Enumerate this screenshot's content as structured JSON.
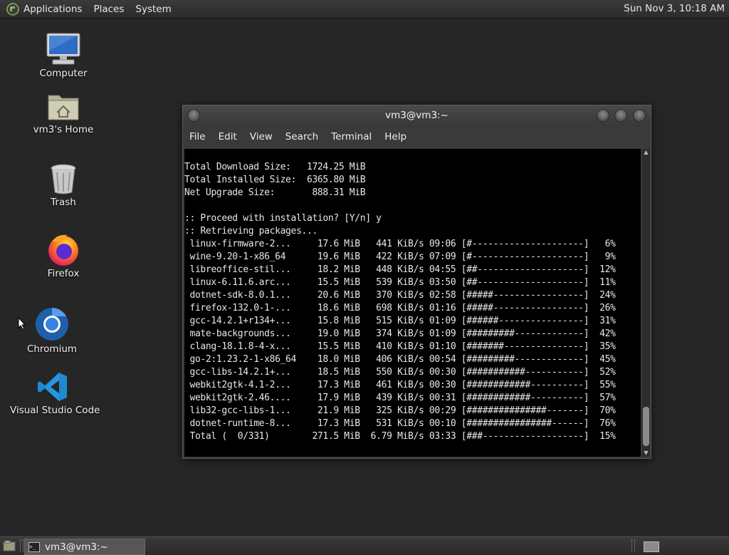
{
  "top_panel": {
    "menus": [
      "Applications",
      "Places",
      "System"
    ],
    "clock": "Sun Nov  3, 10:18 AM"
  },
  "desktop": {
    "icons": [
      {
        "label": "Computer",
        "icon": "computer-icon"
      },
      {
        "label": "vm3's Home",
        "icon": "home-folder-icon"
      },
      {
        "label": "Trash",
        "icon": "trash-icon"
      },
      {
        "label": "Firefox",
        "icon": "firefox-icon"
      },
      {
        "label": "Chromium",
        "icon": "chromium-icon"
      },
      {
        "label": "Visual Studio Code",
        "icon": "vscode-icon"
      }
    ]
  },
  "terminal": {
    "title": "vm3@vm3:~",
    "menu": [
      "File",
      "Edit",
      "View",
      "Search",
      "Terminal",
      "Help"
    ],
    "lines": [
      "Total Download Size:   1724.25 MiB",
      "Total Installed Size:  6365.80 MiB",
      "Net Upgrade Size:       888.31 MiB",
      "",
      ":: Proceed with installation? [Y/n] y",
      ":: Retrieving packages...",
      " linux-firmware-2...     17.6 MiB   441 KiB/s 09:06 [#---------------------]   6%",
      " wine-9.20-1-x86_64      19.6 MiB   422 KiB/s 07:09 [#---------------------]   9%",
      " libreoffice-stil...     18.2 MiB   448 KiB/s 04:55 [##--------------------]  12%",
      " linux-6.11.6.arc...     15.5 MiB   539 KiB/s 03:50 [##--------------------]  11%",
      " dotnet-sdk-8.0.1...     20.6 MiB   370 KiB/s 02:58 [#####-----------------]  24%",
      " firefox-132.0-1-...     18.6 MiB   698 KiB/s 01:16 [#####-----------------]  26%",
      " gcc-14.2.1+r134+...     15.8 MiB   515 KiB/s 01:09 [######----------------]  31%",
      " mate-backgrounds...     19.0 MiB   374 KiB/s 01:09 [#########-------------]  42%",
      " clang-18.1.8-4-x...     15.5 MiB   410 KiB/s 01:10 [#######---------------]  35%",
      " go-2:1.23.2-1-x86_64    18.0 MiB   406 KiB/s 00:54 [#########-------------]  45%",
      " gcc-libs-14.2.1+...     18.5 MiB   550 KiB/s 00:30 [###########-----------]  52%",
      " webkit2gtk-4.1-2...     17.3 MiB   461 KiB/s 00:30 [############----------]  55%",
      " webkit2gtk-2.46....     17.9 MiB   439 KiB/s 00:31 [############----------]  57%",
      " lib32-gcc-libs-1...     21.9 MiB   325 KiB/s 00:29 [###############-------]  70%",
      " dotnet-runtime-8...     17.3 MiB   531 KiB/s 00:10 [################------]  76%",
      " Total (  0/331)        271.5 MiB  6.79 MiB/s 03:33 [###-------------------]  15%"
    ]
  },
  "taskbar": {
    "window_button": "vm3@vm3:~"
  }
}
